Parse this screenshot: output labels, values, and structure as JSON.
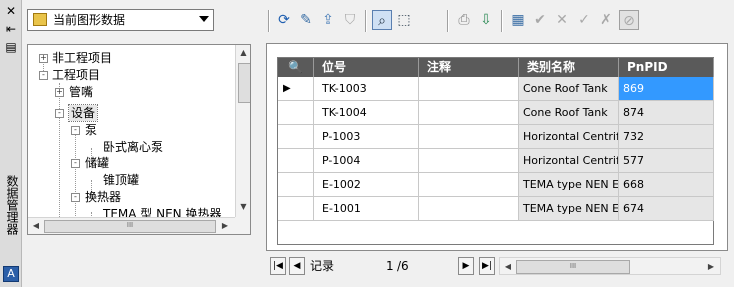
{
  "palette": {
    "title": "数据管理器",
    "buttons": {
      "close": "✕",
      "autohide": "⇤",
      "properties": "▤"
    },
    "app_logo": "A"
  },
  "dropdown": {
    "value": "当前图形数据"
  },
  "tree": {
    "nodes": [
      {
        "label": "非工程项目",
        "toggle": "+"
      },
      {
        "label": "工程项目",
        "toggle": "-"
      },
      {
        "label": "管嘴",
        "toggle": "+"
      },
      {
        "label": "设备",
        "toggle": "-"
      },
      {
        "label": "泵",
        "toggle": "-"
      },
      {
        "label": "卧式离心泵",
        "toggle": ""
      },
      {
        "label": "储罐",
        "toggle": "-"
      },
      {
        "label": "锥顶罐",
        "toggle": ""
      },
      {
        "label": "换热器",
        "toggle": "-"
      },
      {
        "label": "TEMA 型 NEN 换热器",
        "toggle": ""
      }
    ],
    "scroll_grip": "III"
  },
  "toolbar": {
    "icons": [
      "refresh-icon",
      "edit-icon",
      "export-icon",
      "filter-icon",
      "zoom-icon",
      "select-icon",
      "print-icon",
      "import-icon",
      "view-icon",
      "accept-icon",
      "reject-icon",
      "accept-all-icon",
      "reject-all-icon",
      "hide-icon"
    ]
  },
  "grid": {
    "columns": [
      "",
      "位号",
      "注释",
      "类别名称",
      "PnPID"
    ],
    "rows": [
      {
        "tag": "TK-1003",
        "note": "",
        "class": "Cone Roof Tank",
        "pnpid": "869"
      },
      {
        "tag": "TK-1004",
        "note": "",
        "class": "Cone Roof Tank",
        "pnpid": "874"
      },
      {
        "tag": "P-1003",
        "note": "",
        "class": "Horizontal Centrif...",
        "pnpid": "732"
      },
      {
        "tag": "P-1004",
        "note": "",
        "class": "Horizontal Centrif...",
        "pnpid": "577"
      },
      {
        "tag": "E-1002",
        "note": "",
        "class": "TEMA type NEN E...",
        "pnpid": "668"
      },
      {
        "tag": "E-1001",
        "note": "",
        "class": "TEMA type NEN E...",
        "pnpid": "674"
      }
    ],
    "current_row_marker": "▶"
  },
  "navigation": {
    "label": "记录",
    "current": "1",
    "total": "/6",
    "scroll_grip": "III"
  }
}
